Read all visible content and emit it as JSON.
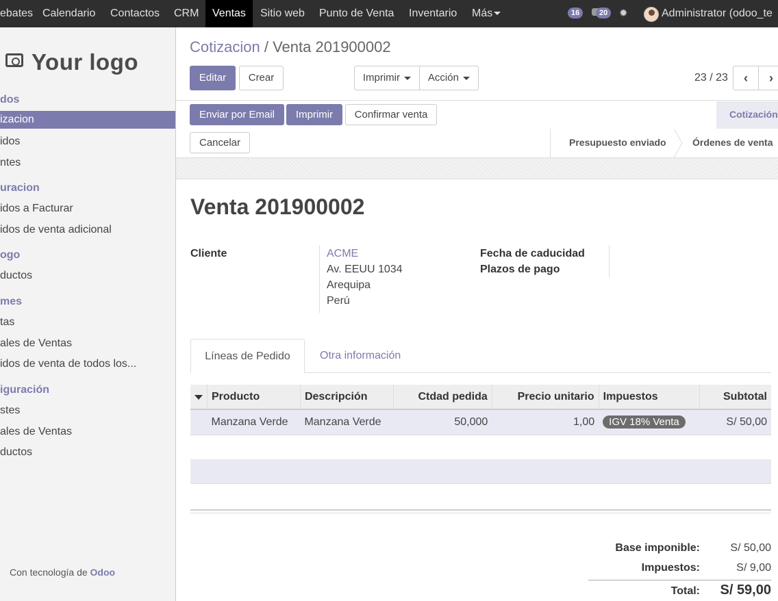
{
  "topnav": {
    "items": [
      "ebates",
      "Calendario",
      "Contactos",
      "CRM",
      "Ventas",
      "Sitio web",
      "Punto de Venta",
      "Inventario",
      "Más"
    ],
    "active": "Ventas",
    "activity_count": "16",
    "messages_count": "20",
    "user": "Administrator (odoo_te"
  },
  "sidebar": {
    "logo_text": "Your logo",
    "sections": [
      {
        "title": "dos",
        "items": [
          "izacion",
          "idos",
          "ntes"
        ]
      },
      {
        "title": "uracion",
        "items": [
          "idos a Facturar",
          "idos de venta adicional"
        ]
      },
      {
        "title": "ogo",
        "items": [
          "ductos"
        ]
      },
      {
        "title": "mes",
        "items": [
          "tas",
          "ales de Ventas",
          "idos de venta de todos los..."
        ]
      },
      {
        "title": "iguración",
        "items": [
          "stes",
          "ales de Ventas",
          "ductos"
        ]
      }
    ],
    "powered_prefix": "Con tecnología de",
    "powered_brand": "Odoo"
  },
  "breadcrumb": {
    "parent": "Cotizacion",
    "separator": "/",
    "current": "Venta 201900002"
  },
  "toolbar": {
    "edit": "Editar",
    "create": "Crear",
    "print": "Imprimir",
    "action": "Acción",
    "pager": "23 / 23"
  },
  "statusbar": {
    "send_email": "Enviar por Email",
    "print": "Imprimir",
    "confirm": "Confirmar venta",
    "cancel": "Cancelar",
    "stages": [
      "Cotización",
      "Presupuesto enviado",
      "Órdenes de venta"
    ],
    "current_stage": "Cotización"
  },
  "form": {
    "title": "Venta 201900002",
    "customer_label": "Cliente",
    "customer_name": "ACME",
    "customer_street": "Av. EEUU 1034",
    "customer_city": "Arequipa",
    "customer_country": "Perú",
    "expiration_label": "Fecha de caducidad",
    "payment_terms_label": "Plazos de pago"
  },
  "tabs": [
    "Líneas de Pedido",
    "Otra información"
  ],
  "order_lines": {
    "columns": [
      "Producto",
      "Descripción",
      "Ctdad pedida",
      "Precio unitario",
      "Impuestos",
      "Subtotal"
    ],
    "rows": [
      {
        "product": "Manzana Verde",
        "description": "Manzana Verde",
        "qty": "50,000",
        "price": "1,00",
        "tax": "IGV 18% Venta",
        "subtotal": "S/ 50,00"
      }
    ]
  },
  "totals": {
    "base_label": "Base imponible:",
    "base_value": "S/ 50,00",
    "tax_label": "Impuestos:",
    "tax_value": "S/ 9,00",
    "total_label": "Total:",
    "total_value": "S/ 59,00"
  }
}
